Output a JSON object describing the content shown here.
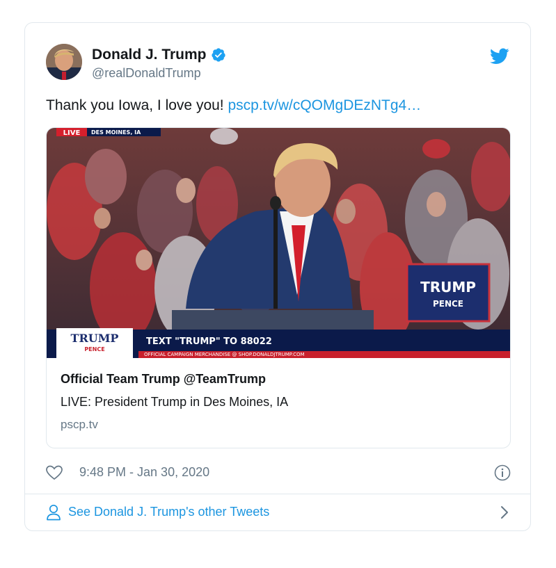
{
  "tweet": {
    "display_name": "Donald J. Trump",
    "handle": "@realDonaldTrump",
    "text": "Thank you Iowa, I love you! ",
    "link_text": "pscp.tv/w/cQOMgDEzNTg4…",
    "timestamp": "9:48 PM - Jan 30, 2020"
  },
  "card": {
    "title": "Official Team Trump @TeamTrump",
    "description": "LIVE: President Trump in Des Moines, IA",
    "domain": "pscp.tv",
    "overlay": {
      "live_badge": "LIVE",
      "location": "DES MOINES, IA",
      "logo_line1": "TRUMP",
      "logo_line2": "PENCE",
      "text_prompt": "TEXT \"TRUMP\" TO 88022",
      "ticker": "OFFICIAL CAMPAIGN MERCHANDISE @ SHOP.DONALDJTRUMP.COM",
      "sign_line1": "TRUMP",
      "sign_line2": "PENCE"
    }
  },
  "footer": {
    "label": "See Donald J. Trump's other Tweets"
  },
  "icons": {
    "verified": "verified-badge-icon",
    "twitter": "twitter-bird-icon",
    "like": "heart-icon",
    "info": "info-icon",
    "person": "person-icon",
    "chevron": "chevron-right-icon"
  },
  "colors": {
    "accent": "#1da1f2",
    "link": "#1b95e0",
    "secondary_text": "#657786",
    "border": "#e1e8ed",
    "live_red": "#d51f2c",
    "lower_third_navy": "#0b1a4a"
  }
}
